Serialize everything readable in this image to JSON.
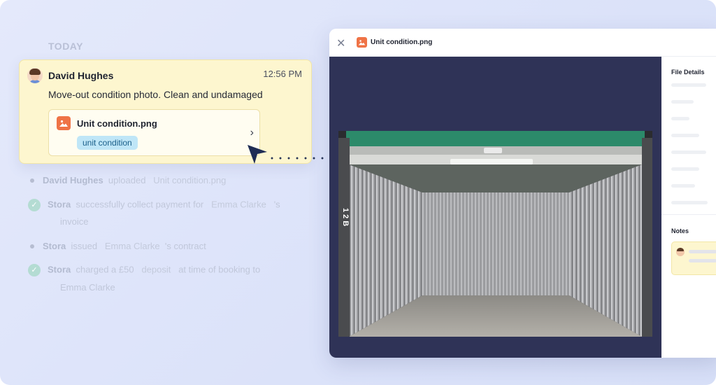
{
  "feed": {
    "day_label": "TODAY",
    "message": {
      "sender": "David Hughes",
      "time": "12:56 PM",
      "text": "Move-out condition photo. Clean and undamaged",
      "attachment": {
        "file_name": "Unit condition.png",
        "tag": "unit condition"
      }
    },
    "events": [
      {
        "actor": "David Hughes",
        "action": "uploaded",
        "object": "Unit condition.png"
      },
      {
        "actor": "Stora",
        "action": "successfully collect payment for",
        "object": "Emma Clarke",
        "suffix": "'s",
        "line2": "invoice"
      },
      {
        "actor": "Stora",
        "action": "issued",
        "object": "Emma Clarke",
        "suffix": "'s contract"
      },
      {
        "actor": "Stora",
        "action": "charged a £50",
        "object": "deposit",
        "suffix": "at time of booking to",
        "line2": "Emma Clarke"
      }
    ]
  },
  "viewer": {
    "title": "Unit condition.png",
    "unit_label": "12B",
    "panel": {
      "file_details_label": "File Details",
      "notes_label": "Notes"
    }
  },
  "colors": {
    "accent_orange": "#ef7346",
    "card_yellow": "#fdf6cf",
    "tag_blue": "#bfe6f7",
    "stage_navy": "#2f3357"
  }
}
